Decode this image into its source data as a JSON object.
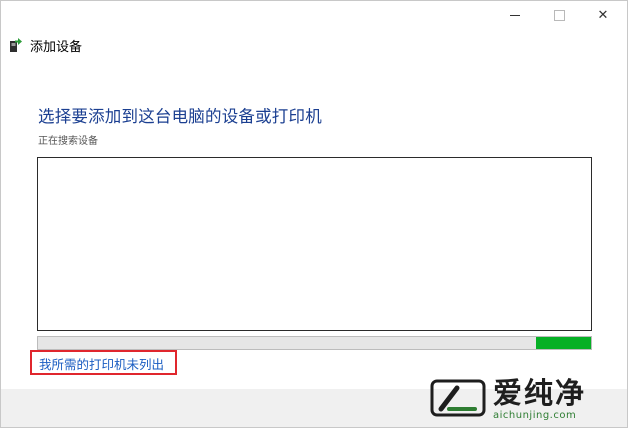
{
  "window": {
    "title": "添加设备",
    "controls": {
      "minimize": "minimize-icon",
      "maximize": "maximize-icon",
      "close_glyph": "✕"
    }
  },
  "main": {
    "heading": "选择要添加到这台电脑的设备或打印机",
    "status": "正在搜索设备",
    "progress_fraction": 0.1,
    "missing_printer_link": "我所需的打印机未列出"
  },
  "watermark": {
    "brand": "爱纯净",
    "url": "aichunjing.com"
  },
  "colors": {
    "heading": "#1b3f91",
    "link": "#1a5dc2",
    "progress_fill": "#06b025",
    "highlight_box": "#e0262d",
    "watermark_url": "#2e7d32"
  }
}
